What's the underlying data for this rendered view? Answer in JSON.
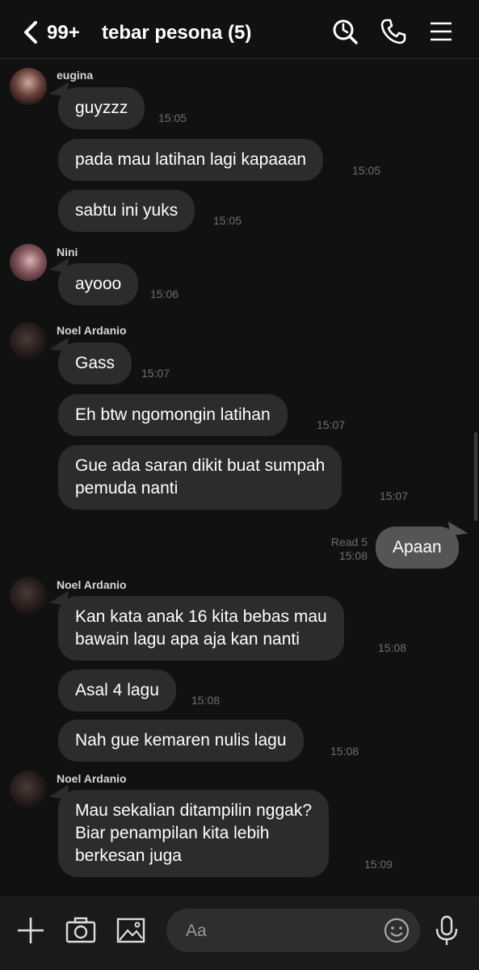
{
  "header": {
    "back_count": "99+",
    "title": "tebar pesona (5)"
  },
  "messages": [
    {
      "sender": "eugina",
      "text": "guyzzz",
      "time": "15:05"
    },
    {
      "text": "pada mau latihan lagi kapaaan",
      "time": "15:05"
    },
    {
      "text": "sabtu ini yuks",
      "time": "15:05"
    },
    {
      "sender": "Nini",
      "text": "ayooo",
      "time": "15:06"
    },
    {
      "sender": "Noel Ardanio",
      "text": "Gass",
      "time": "15:07"
    },
    {
      "text": "Eh btw ngomongin latihan",
      "time": "15:07"
    },
    {
      "text": "Gue ada saran dikit buat sumpah\npemuda nanti",
      "time": "15:07"
    },
    {
      "mine": true,
      "text": "Apaan",
      "read": "Read 5",
      "time": "15:08"
    },
    {
      "sender": "Noel Ardanio",
      "text": "Kan kata anak 16 kita bebas mau\nbawain lagu apa aja kan nanti",
      "time": "15:08"
    },
    {
      "text": "Asal 4 lagu",
      "time": "15:08"
    },
    {
      "text": "Nah gue kemaren nulis lagu",
      "time": "15:08"
    },
    {
      "sender": "Noel Ardanio",
      "text": "Mau sekalian ditampilin nggak?\nBiar penampilan kita lebih\nberkesan juga",
      "time": "15:09"
    }
  ],
  "composer": {
    "placeholder": "Aa"
  },
  "icons": {
    "header": [
      "back-chevron-icon",
      "search-icon",
      "phone-icon",
      "menu-icon"
    ],
    "footer": [
      "plus-icon",
      "camera-icon",
      "image-icon",
      "emoji-icon",
      "microphone-icon"
    ]
  }
}
